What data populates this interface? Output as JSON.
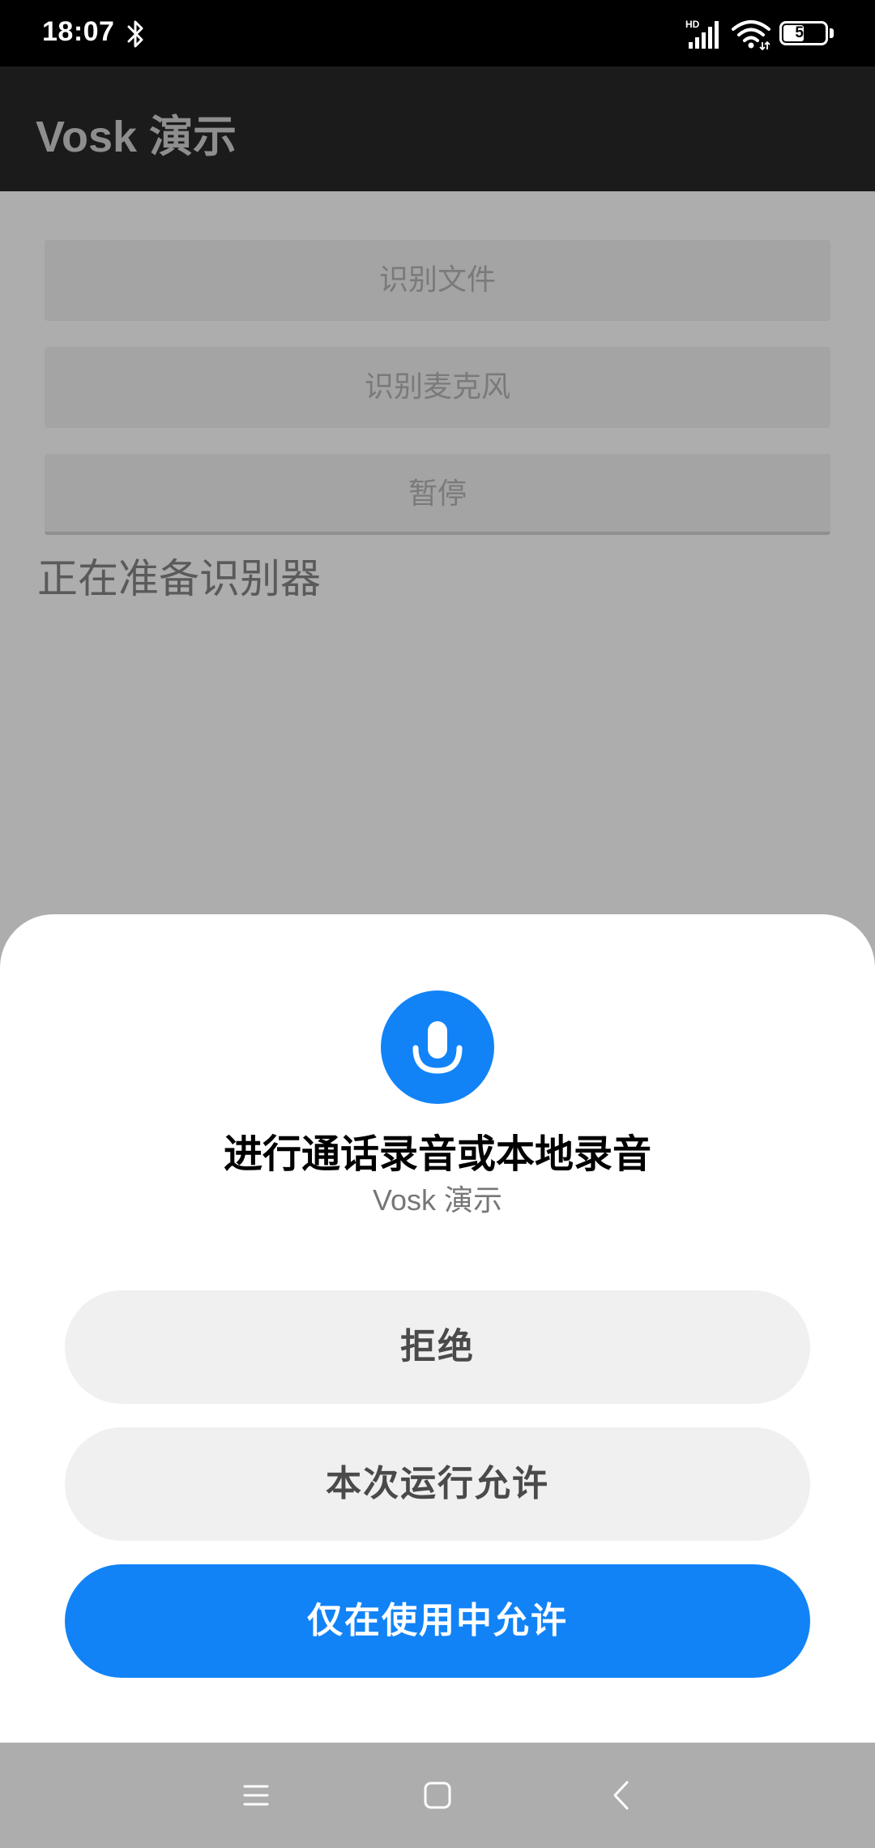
{
  "status_bar": {
    "time": "18:07",
    "battery_level": "50",
    "icons": [
      "bluetooth-icon",
      "hd-signal-icon",
      "wifi-icon",
      "battery-icon"
    ]
  },
  "app_bar": {
    "title": "Vosk 演示"
  },
  "main": {
    "buttons": [
      {
        "label": "识别文件"
      },
      {
        "label": "识别麦克风"
      },
      {
        "label": "暂停"
      }
    ],
    "status_text": "正在准备识别器"
  },
  "permission_dialog": {
    "icon": "microphone-icon",
    "title": "进行通话录音或本地录音",
    "app_name": "Vosk 演示",
    "deny_label": "拒绝",
    "allow_once_label": "本次运行允许",
    "allow_while_using_label": "仅在使用中允许"
  },
  "nav_bar": {
    "icons": [
      "menu-icon",
      "home-icon",
      "back-icon"
    ]
  },
  "colors": {
    "accent": "#1183f7",
    "status_bar": "#000000",
    "app_bar": "#1b1b1b",
    "scrim": "#adadad"
  }
}
